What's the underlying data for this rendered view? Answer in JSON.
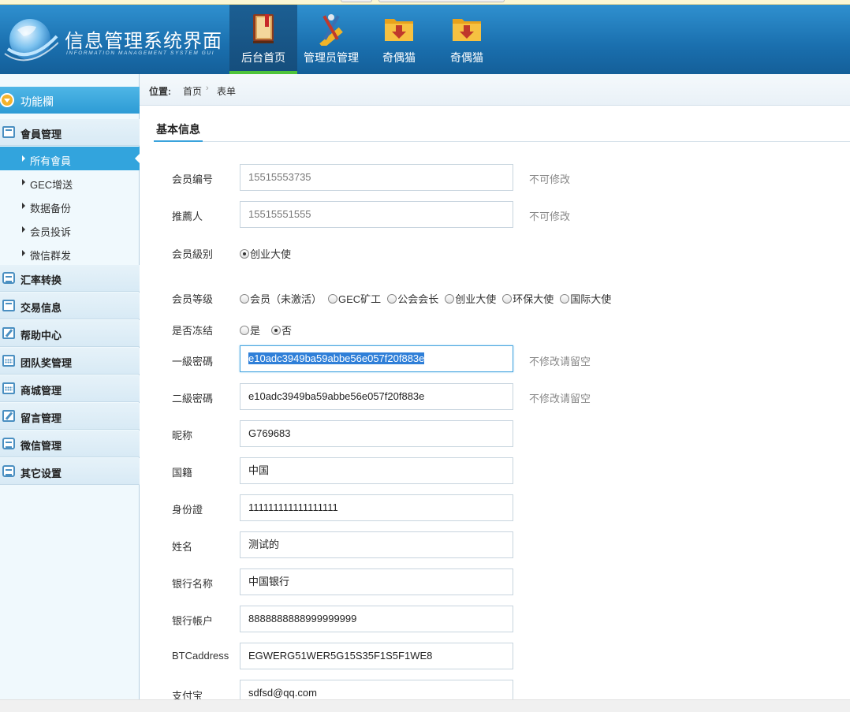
{
  "header": {
    "title": "信息管理系统界面",
    "subtitle": "INFORMATION MANAGEMENT SYSTEM GUI",
    "nav": [
      {
        "label": "后台首页",
        "icon": "book-icon",
        "active": true
      },
      {
        "label": "管理员管理",
        "icon": "tools-icon",
        "active": false
      },
      {
        "label": "奇偶猫",
        "icon": "folder-download-icon",
        "active": false
      },
      {
        "label": "奇偶猫",
        "icon": "folder-download-icon",
        "active": false
      }
    ]
  },
  "sidebar": {
    "header": "功能欄",
    "groups": [
      {
        "label": "會員管理",
        "icon": "list-icon"
      },
      {
        "label": "汇率转换",
        "icon": "chat-icon"
      },
      {
        "label": "交易信息",
        "icon": "list-icon"
      },
      {
        "label": "帮助中心",
        "icon": "edit-icon"
      },
      {
        "label": "团队奖管理",
        "icon": "calendar-icon"
      },
      {
        "label": "商城管理",
        "icon": "calendar-icon"
      },
      {
        "label": "留言管理",
        "icon": "edit-icon"
      },
      {
        "label": "微信管理",
        "icon": "chat-icon"
      },
      {
        "label": "其它设置",
        "icon": "chat-icon"
      }
    ],
    "subitems": [
      {
        "label": "所有會員",
        "active": true
      },
      {
        "label": "GEC增送",
        "active": false
      },
      {
        "label": "数据备份",
        "active": false
      },
      {
        "label": "会员投诉",
        "active": false
      },
      {
        "label": "微信群发",
        "active": false
      }
    ]
  },
  "breadcrumb": {
    "label": "位置:",
    "home": "首页",
    "separator": "›",
    "current": "表单"
  },
  "tab": "基本信息",
  "form": {
    "member_id": {
      "label": "会员编号",
      "value": "15515553735",
      "hint": "不可修改"
    },
    "referrer": {
      "label": "推薦人",
      "value": "15515551555",
      "hint": "不可修改"
    },
    "member_type": {
      "label": "会员級别",
      "options": [
        "创业大使"
      ],
      "selected": 0
    },
    "member_level": {
      "label": "会员等级",
      "options": [
        "会员（未激活）",
        "GEC矿工",
        "公会会长",
        "创业大使",
        "环保大使",
        "国际大使"
      ],
      "selected": -1
    },
    "frozen": {
      "label": "是否冻结",
      "options": [
        "是",
        "否"
      ],
      "selected": 1
    },
    "password1": {
      "label": "一級密碼",
      "value": "e10adc3949ba59abbe56e057f20f883e",
      "hint": "不修改请留空"
    },
    "password2": {
      "label": "二級密碼",
      "value": "e10adc3949ba59abbe56e057f20f883e",
      "hint": "不修改请留空"
    },
    "nickname": {
      "label": "昵称",
      "value": "G769683"
    },
    "nationality": {
      "label": "国籍",
      "value": "中国"
    },
    "id_card": {
      "label": "身份證",
      "value": "111111111111111111"
    },
    "name": {
      "label": "姓名",
      "value": "测试的"
    },
    "bank_name": {
      "label": "银行名称",
      "value": "中国银行"
    },
    "bank_account": {
      "label": "银行帳户",
      "value": "8888888888999999999"
    },
    "btc_address": {
      "label": "BTCaddress",
      "value": "EGWERG51WER5G15S35F1S5F1WE8"
    },
    "alipay": {
      "label": "支付宝",
      "value": "sdfsd@qq.com"
    }
  },
  "colors": {
    "header": "#1a6fae",
    "accent": "#32a4dd",
    "active_nav_border": "#4fc43a"
  }
}
